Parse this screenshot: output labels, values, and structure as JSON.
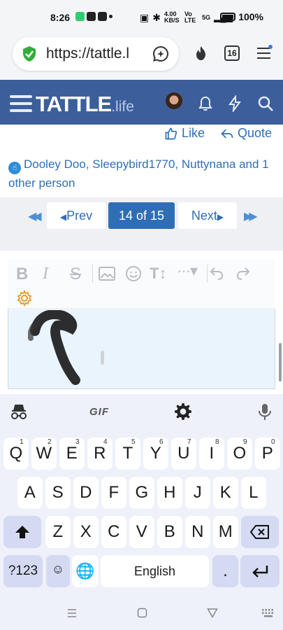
{
  "status": {
    "time": "8:26",
    "net_speed": "4.00 KB/S",
    "volte": "Vo LTE",
    "signal": "5G",
    "battery": "100%"
  },
  "browser": {
    "url": "https://tattle.l",
    "tab_count": "16"
  },
  "site": {
    "logo_main": "TATTLE",
    "logo_suffix": ".life"
  },
  "post": {
    "like_label": "Like",
    "quote_label": "Quote",
    "reactions_text": "Dooley Doo, Sleepybird1770, Nuttynana and 1 other person"
  },
  "pagination": {
    "prev_label": "Prev",
    "current": "14 of 15",
    "next_label": "Next"
  },
  "keyboard": {
    "gif_label": "GIF",
    "row1": [
      "Q",
      "W",
      "E",
      "R",
      "T",
      "Y",
      "U",
      "I",
      "O",
      "P"
    ],
    "row1_hints": [
      "1",
      "2",
      "3",
      "4",
      "5",
      "6",
      "7",
      "8",
      "9",
      "0"
    ],
    "row2": [
      "A",
      "S",
      "D",
      "F",
      "G",
      "H",
      "J",
      "K",
      "L"
    ],
    "row3": [
      "Z",
      "X",
      "C",
      "V",
      "B",
      "N",
      "M"
    ],
    "symbols_label": "?123",
    "space_label": "English",
    "period_label": "."
  },
  "colors": {
    "header_bg": "#3c5f9c",
    "accent": "#2f6eb5",
    "editor_bg": "#eaf4fd",
    "keyboard_bg": "#eef0fa"
  }
}
